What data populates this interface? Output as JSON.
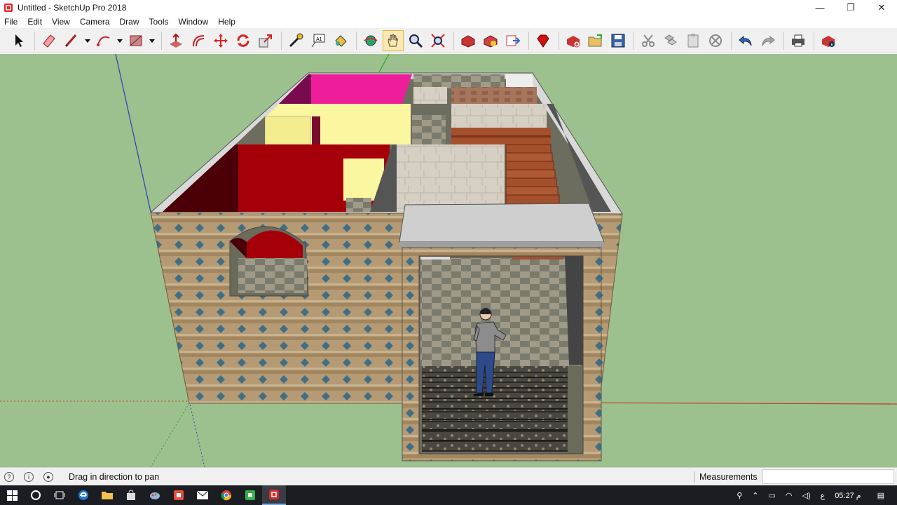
{
  "window": {
    "title": "Untitled - SketchUp Pro 2018",
    "controls": [
      "—",
      "❐",
      "✕"
    ]
  },
  "menu": [
    "File",
    "Edit",
    "View",
    "Camera",
    "Draw",
    "Tools",
    "Window",
    "Help"
  ],
  "toolbar": {
    "tools": [
      "select-tool-icon",
      "eraser-tool-icon",
      "line-tool-icon",
      "arc-tool-icon",
      "rectangle-tool-icon",
      "push-pull-tool-icon",
      "offset-tool-icon",
      "move-tool-icon",
      "rotate-tool-icon",
      "scale-tool-icon",
      "tape-measure-icon",
      "text-tool-icon",
      "paint-bucket-icon",
      "orbit-tool-icon",
      "pan-tool-icon",
      "zoom-tool-icon",
      "zoom-extents-icon",
      "warehouse-icon",
      "extension-warehouse-icon",
      "send-to-layout-icon",
      "ruby-icon",
      "new-file-icon",
      "open-file-icon",
      "save-file-icon",
      "cut-icon",
      "copy-icon",
      "paste-icon",
      "delete-icon",
      "undo-icon",
      "redo-icon",
      "print-icon",
      "model-info-icon"
    ]
  },
  "status": {
    "hint": "Drag in direction to pan",
    "measurements_label": "Measurements",
    "measurements_value": ""
  },
  "taskbar": {
    "clock": "05:27 م",
    "lang": "ع"
  },
  "colors": {
    "ground": "#9dc08f",
    "wall_brick": "#b59a73",
    "magenta_room": "#ee1e9b",
    "yellow_room": "#fbf6a0",
    "red_room": "#a5000a",
    "roof_slab": "#cfcfcf"
  }
}
